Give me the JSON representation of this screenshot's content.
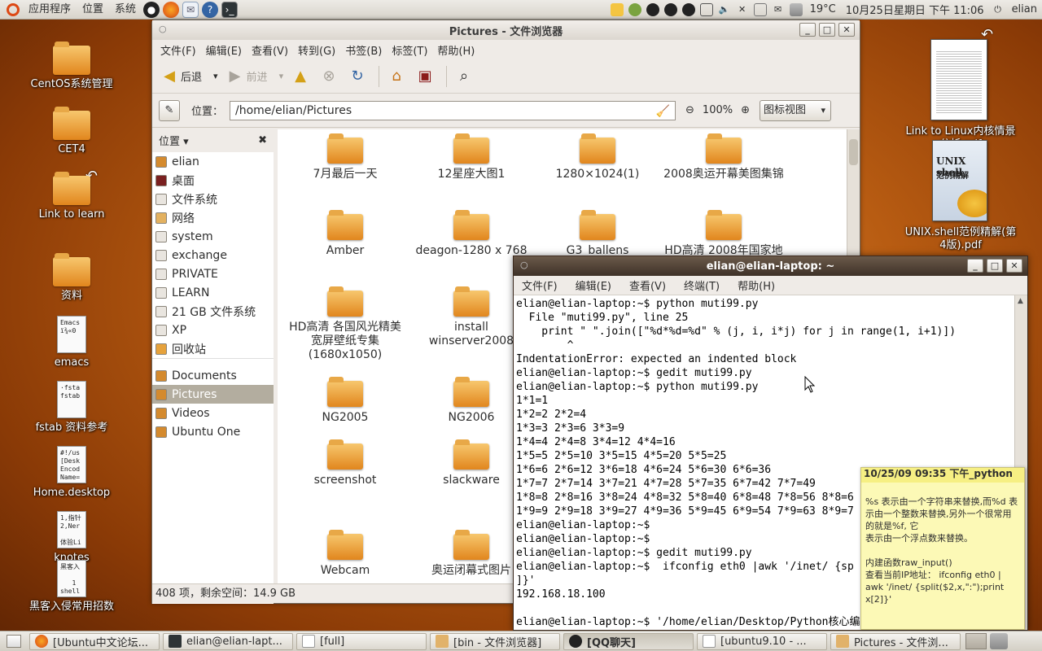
{
  "top_panel": {
    "menus": [
      "应用程序",
      "位置",
      "系统"
    ],
    "launchers": [
      "qq-icon",
      "firefox-icon",
      "mail-icon",
      "help-icon",
      "terminal-icon"
    ],
    "weather": "19°C",
    "datetime": "10月25日星期日 下午 11:06",
    "user": "elian"
  },
  "desktop_icons": [
    {
      "label": "CentOS系统管理",
      "kind": "folder"
    },
    {
      "label": "CET4",
      "kind": "folder"
    },
    {
      "label": "Link to learn",
      "kind": "folder-link"
    },
    {
      "label": "资料",
      "kind": "folder"
    },
    {
      "label": "emacs",
      "kind": "file",
      "preview": "Emacs\nï¾«0"
    },
    {
      "label": "fstab 资料参考",
      "kind": "file",
      "preview": "·fsta\nfstab"
    },
    {
      "label": "Home.desktop",
      "kind": "file",
      "preview": "#!/us\n[Desk\nEncod\nName="
    },
    {
      "label": "knotes",
      "kind": "file",
      "preview": "1,指针\n2,Ner\n\n体验Li"
    },
    {
      "label": "黑客入侵常用招数",
      "kind": "file",
      "preview": "黑客入\n\n   1\nshell"
    }
  ],
  "right_desktop": [
    {
      "label": "Link to Linux内核情景分析.pdf"
    },
    {
      "label": "UNIX.shell范例精解(第4版).pdf",
      "cover_title": "UNIX shell",
      "cover_sub": "范例精解"
    }
  ],
  "file_browser": {
    "title": "Pictures - 文件浏览器",
    "menu": [
      "文件(F)",
      "编辑(E)",
      "查看(V)",
      "转到(G)",
      "书签(B)",
      "标签(T)",
      "帮助(H)"
    ],
    "toolbar": {
      "back": "后退",
      "forward": "前进"
    },
    "location_label": "位置：",
    "location_value": "/home/elian/Pictures",
    "zoom": "100%",
    "view_mode": "图标视图",
    "sidebar_header": "位置",
    "sidebar_places": [
      "elian",
      "桌面",
      "文件系统",
      "网络",
      "system",
      "exchange",
      "PRIVATE",
      "LEARN",
      "21 GB 文件系统",
      "XP",
      "回收站"
    ],
    "sidebar_bookmarks": [
      "Documents",
      "Pictures",
      "Videos",
      "Ubuntu One"
    ],
    "selected_bookmark": "Pictures",
    "folders": [
      "7月最后一天",
      "12星座大图1",
      "1280×1024(1)",
      "2008奥运开幕美图集锦",
      "Amber",
      "deagon-1280 x 768",
      "G3_ballens",
      "HD高清 2008年国家地",
      "HD高清 各国风光精美宽屏壁纸专集(1680x1050)",
      "install winserver2008",
      "NG2005",
      "NG2006",
      "screenshot",
      "slackware",
      "Webcam",
      "奥运闭幕式图片"
    ],
    "status": "408 项，剩余空间：14.9 GB"
  },
  "terminal": {
    "title": "elian@elian-laptop: ~",
    "menu": [
      "文件(F)",
      "编辑(E)",
      "查看(V)",
      "终端(T)",
      "帮助(H)"
    ],
    "lines": [
      "elian@elian-laptop:~$ python muti99.py",
      "  File \"muti99.py\", line 25",
      "    print \" \".join([\"%d*%d=%d\" % (j, i, i*j) for j in range(1, i+1)])",
      "        ^",
      "IndentationError: expected an indented block",
      "elian@elian-laptop:~$ gedit muti99.py",
      "elian@elian-laptop:~$ python muti99.py",
      "1*1=1",
      "1*2=2 2*2=4",
      "1*3=3 2*3=6 3*3=9",
      "1*4=4 2*4=8 3*4=12 4*4=16",
      "1*5=5 2*5=10 3*5=15 4*5=20 5*5=25",
      "1*6=6 2*6=12 3*6=18 4*6=24 5*6=30 6*6=36",
      "1*7=7 2*7=14 3*7=21 4*7=28 5*7=35 6*7=42 7*7=49",
      "1*8=8 2*8=16 3*8=24 4*8=32 5*8=40 6*8=48 7*8=56 8*8=6",
      "1*9=9 2*9=18 3*9=27 4*9=36 5*9=45 6*9=54 7*9=63 8*9=7",
      "elian@elian-laptop:~$",
      "elian@elian-laptop:~$",
      "elian@elian-laptop:~$ gedit muti99.py",
      "elian@elian-laptop:~$  ifconfig eth0 |awk '/inet/ {sp",
      "]}'",
      "192.168.18.100",
      "",
      "elian@elian-laptop:~$ '/home/elian/Desktop/Python核心编"
    ]
  },
  "sticky_note": {
    "header": "10/25/09 09:35 下午_python",
    "body": "%s 表示由一个字符串来替换,而%d 表示由一个整数来替换,另外一个很常用的就是%f, 它\n表示由一个浮点数来替换。\n\n内建函数raw_input()\n查看当前IP地址： ifconfig eth0 | awk '/inet/ {split($2,x,\":\");print x[2]}'"
  },
  "taskbar": [
    {
      "label": "[Ubuntu中文论坛...",
      "icon": "firefox-icon",
      "active": false
    },
    {
      "label": "elian@elian-lapt...",
      "icon": "terminal-icon",
      "active": false
    },
    {
      "label": "[full]",
      "icon": "document-icon",
      "active": false
    },
    {
      "label": "[bin - 文件浏览器]",
      "icon": "folder-icon",
      "active": false
    },
    {
      "label": "[QQ聊天]",
      "icon": "qq-icon",
      "active": true
    },
    {
      "label": "[ubuntu9.10 - ...",
      "icon": "document-icon",
      "active": false
    },
    {
      "label": "Pictures - 文件浏...",
      "icon": "folder-icon",
      "active": false
    }
  ]
}
